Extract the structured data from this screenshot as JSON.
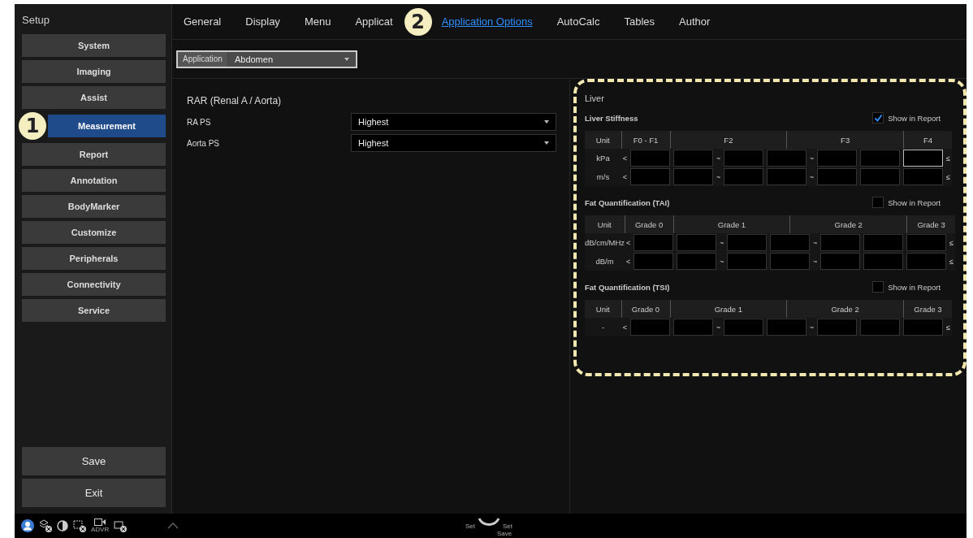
{
  "sidebar": {
    "title": "Setup",
    "items": [
      {
        "label": "System",
        "selected": false
      },
      {
        "label": "Imaging",
        "selected": false
      },
      {
        "label": "Assist",
        "selected": false
      },
      {
        "label": "Measurement",
        "selected": true
      },
      {
        "label": "Report",
        "selected": false
      },
      {
        "label": "Annotation",
        "selected": false
      },
      {
        "label": "BodyMarker",
        "selected": false
      },
      {
        "label": "Customize",
        "selected": false
      },
      {
        "label": "Peripherals",
        "selected": false
      },
      {
        "label": "Connectivity",
        "selected": false
      },
      {
        "label": "Service",
        "selected": false
      }
    ],
    "buttons": [
      "Save",
      "Exit"
    ]
  },
  "tabs": [
    {
      "label": "General",
      "selected": false
    },
    {
      "label": "Display",
      "selected": false
    },
    {
      "label": "Menu",
      "selected": false
    },
    {
      "label": "Applicat",
      "selected": false
    },
    {
      "label": "Application Options",
      "selected": true
    },
    {
      "label": "AutoCalc",
      "selected": false
    },
    {
      "label": "Tables",
      "selected": false
    },
    {
      "label": "Author",
      "selected": false
    }
  ],
  "callouts": [
    {
      "label": "1"
    },
    {
      "label": "2"
    }
  ],
  "application": {
    "label": "Application",
    "value": "Abdomen"
  },
  "rar": {
    "title": "RAR (Renal A / Aorta)",
    "rows": [
      {
        "label": "RA PS",
        "value": "Highest"
      },
      {
        "label": "Aorta PS",
        "value": "Highest"
      }
    ]
  },
  "liver": {
    "title": "Liver",
    "sections": [
      {
        "title": "Liver Stiffness",
        "show_in_report": {
          "label": "Show in Report",
          "checked": true
        },
        "columns": [
          "Unit",
          "F0 - F1",
          "F2",
          "F3",
          "F4"
        ],
        "rows": [
          {
            "unit": "kPa",
            "lower": "<",
            "tildes": [
              "~",
              "~"
            ],
            "upper": "≤",
            "fields": [
              {
                "focused": false
              },
              {
                "focused": false
              },
              {
                "focused": false
              },
              {
                "focused": false
              },
              {
                "focused": false
              },
              {
                "focused": false
              },
              {
                "focused": true
              }
            ]
          },
          {
            "unit": "m/s",
            "lower": "<",
            "tildes": [
              "~",
              "~"
            ],
            "upper": "≤",
            "fields": [
              {
                "focused": false
              },
              {
                "focused": false
              },
              {
                "focused": false
              },
              {
                "focused": false
              },
              {
                "focused": false
              },
              {
                "focused": false
              },
              {
                "focused": false
              }
            ]
          }
        ]
      },
      {
        "title": "Fat Quantification (TAI)",
        "show_in_report": {
          "label": "Show in Report",
          "checked": false
        },
        "columns": [
          "Unit",
          "Grade 0",
          "Grade 1",
          "Grade 2",
          "Grade 3"
        ],
        "rows": [
          {
            "unit": "dB/cm/MHz",
            "lower": "<",
            "tildes": [
              "~",
              "~"
            ],
            "upper": "≤",
            "fields": [
              {
                "focused": false
              },
              {
                "focused": false
              },
              {
                "focused": false
              },
              {
                "focused": false
              },
              {
                "focused": false
              },
              {
                "focused": false
              },
              {
                "focused": false
              }
            ]
          },
          {
            "unit": "dB/m",
            "lower": "<",
            "tildes": [
              "~",
              "~"
            ],
            "upper": "≤",
            "fields": [
              {
                "focused": false
              },
              {
                "focused": false
              },
              {
                "focused": false
              },
              {
                "focused": false
              },
              {
                "focused": false
              },
              {
                "focused": false
              },
              {
                "focused": false
              }
            ]
          }
        ]
      },
      {
        "title": "Fat Quantification (TSI)",
        "show_in_report": {
          "label": "Show in Report",
          "checked": false
        },
        "columns": [
          "Unit",
          "Grade 0",
          "Grade 1",
          "Grade 2",
          "Grade 3"
        ],
        "rows": [
          {
            "unit": "-",
            "lower": "<",
            "tildes": [
              "~",
              "~"
            ],
            "upper": "≤",
            "fields": [
              {
                "focused": false
              },
              {
                "focused": false
              },
              {
                "focused": false
              },
              {
                "focused": false
              },
              {
                "focused": false
              },
              {
                "focused": false
              },
              {
                "focused": false
              }
            ]
          }
        ]
      }
    ]
  },
  "status_bar": {
    "adv_label": "ADVR",
    "left_set": "Set",
    "right_set": "Set",
    "save": "Save"
  }
}
